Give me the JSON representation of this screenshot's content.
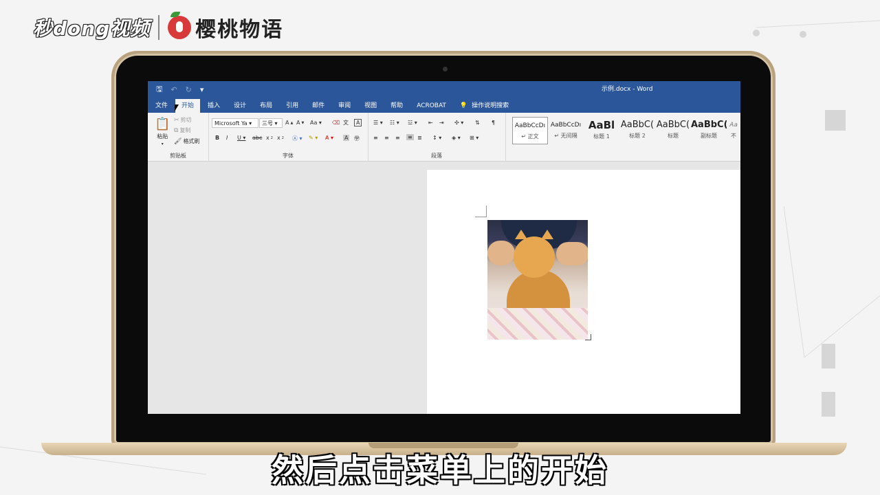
{
  "logos": {
    "miaodong": "秒dong视频",
    "cherry": "樱桃物语"
  },
  "word": {
    "doc_title": "示例.docx  -  Word",
    "tabs": [
      "文件",
      "开始",
      "插入",
      "设计",
      "布局",
      "引用",
      "邮件",
      "审阅",
      "视图",
      "帮助",
      "ACROBAT"
    ],
    "search_label": "操作说明搜索",
    "clipboard": {
      "paste": "粘贴",
      "cut": "剪切",
      "copy": "复制",
      "format_painter": "格式刷",
      "group_label": "剪贴板"
    },
    "font": {
      "font_name": "Microsoft Ya",
      "font_size": "三号",
      "group_label": "字体"
    },
    "paragraph": {
      "group_label": "段落"
    },
    "styles": [
      {
        "sample": "AaBbCcDı",
        "name": "↵ 正文"
      },
      {
        "sample": "AaBbCcDı",
        "name": "↵ 无间隔"
      },
      {
        "sample": "AaBl",
        "name": "标题 1"
      },
      {
        "sample": "AaBbC(",
        "name": "标题 2"
      },
      {
        "sample": "AaBbC(",
        "name": "标题"
      },
      {
        "sample": "AaBbC(",
        "name": "副标题"
      },
      {
        "sample": "Aa",
        "name": "不"
      }
    ]
  },
  "subtitle": "然后点击菜单上的开始"
}
